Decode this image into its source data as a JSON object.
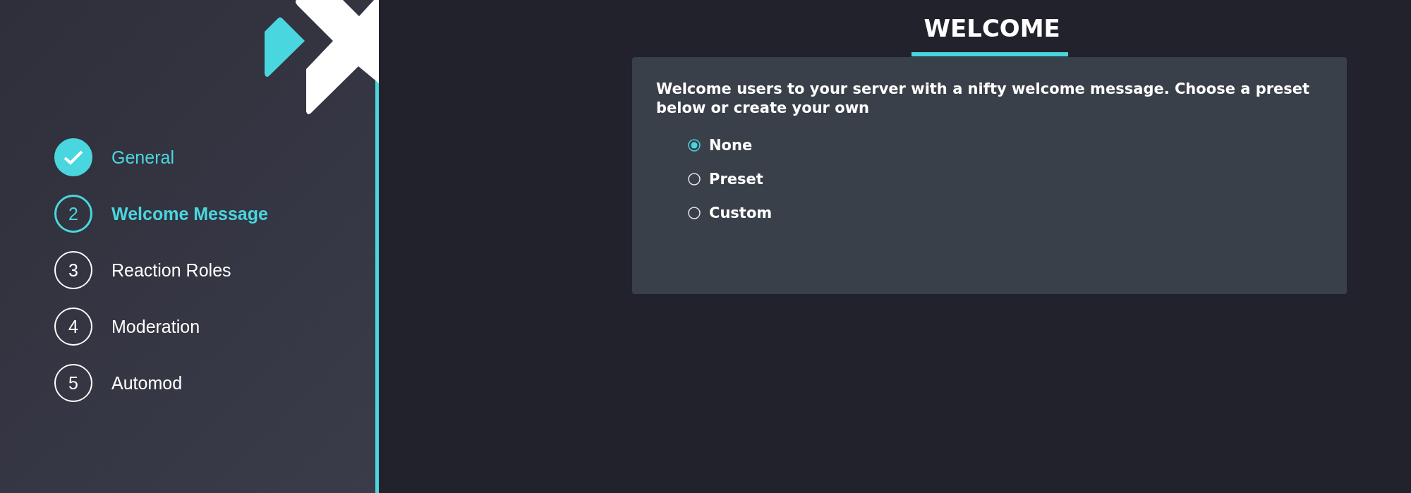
{
  "steps": [
    {
      "label": "General",
      "completed": true,
      "selected": false
    },
    {
      "number": "2",
      "label": "Welcome Message",
      "completed": false,
      "selected": true
    },
    {
      "number": "3",
      "label": "Reaction Roles",
      "completed": false,
      "selected": false
    },
    {
      "number": "4",
      "label": "Moderation",
      "completed": false,
      "selected": false
    },
    {
      "number": "5",
      "label": "Automod",
      "completed": false,
      "selected": false
    }
  ],
  "main": {
    "title": "WELCOME",
    "description": "Welcome users to your server with a nifty welcome message. Choose a preset below or create your own",
    "options": [
      {
        "label": "None",
        "selected": true
      },
      {
        "label": "Preset",
        "selected": false
      },
      {
        "label": "Custom",
        "selected": false
      }
    ]
  }
}
